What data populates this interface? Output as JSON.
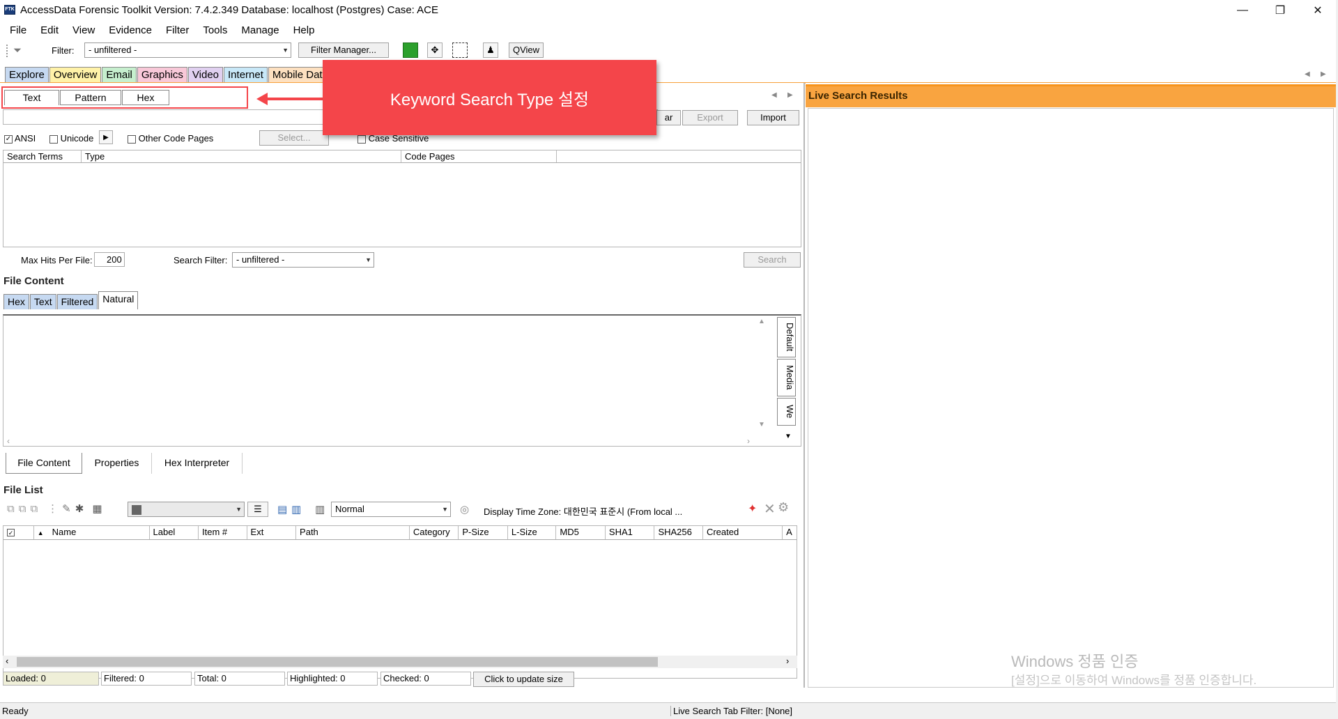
{
  "window": {
    "title": "AccessData Forensic Toolkit Version: 7.4.2.349 Database: localhost (Postgres) Case: ACE",
    "app_icon_text": "FTK",
    "minimize": "—",
    "restore": "❐",
    "close": "✕"
  },
  "menu": [
    "File",
    "Edit",
    "View",
    "Evidence",
    "Filter",
    "Tools",
    "Manage",
    "Help"
  ],
  "toolbar": {
    "filter_label": "Filter:",
    "filter_value": "- unfiltered -",
    "filter_manager": "Filter Manager...",
    "qview": "QView"
  },
  "main_tabs": [
    {
      "label": "Explore",
      "color": "#c6d9f1"
    },
    {
      "label": "Overview",
      "color": "#fff2a8"
    },
    {
      "label": "Email",
      "color": "#c6efce"
    },
    {
      "label": "Graphics",
      "color": "#f8c8d8"
    },
    {
      "label": "Video",
      "color": "#e0d0f0"
    },
    {
      "label": "Internet",
      "color": "#c8e8f8"
    },
    {
      "label": "Mobile Data",
      "color": "#fde0c0"
    }
  ],
  "search": {
    "sub_tabs": [
      "Text",
      "Pattern",
      "Hex"
    ],
    "clear_partial": "ar",
    "export": "Export",
    "import": "Import",
    "ansi": "ANSI",
    "unicode": "Unicode",
    "other_code_pages": "Other Code Pages",
    "select": "Select...",
    "case_sensitive": "Case Sensitive",
    "columns": [
      "Search Terms",
      "Type",
      "Code Pages"
    ],
    "max_hits_label": "Max Hits Per File:",
    "max_hits_value": "200",
    "search_filter_label": "Search Filter:",
    "search_filter_value": "- unfiltered -",
    "search_button": "Search"
  },
  "file_content": {
    "title": "File Content",
    "tabs": [
      "Hex",
      "Text",
      "Filtered",
      "Natural"
    ],
    "side_tabs": [
      "Default",
      "Media",
      "We"
    ],
    "bottom_tabs": [
      "File Content",
      "Properties",
      "Hex Interpreter"
    ]
  },
  "file_list": {
    "title": "File List",
    "view_mode": "Normal",
    "time_zone": "Display Time Zone: 대한민국 표준시  (From local ...",
    "columns": [
      "Name",
      "Label",
      "Item #",
      "Ext",
      "Path",
      "Category",
      "P-Size",
      "L-Size",
      "MD5",
      "SHA1",
      "SHA256",
      "Created",
      "A"
    ],
    "stats": [
      "Loaded: 0",
      "Filtered: 0",
      "Total: 0",
      "Highlighted: 0",
      "Checked: 0"
    ],
    "update_size": "Click to update size"
  },
  "live_search": {
    "title": "Live Search Results"
  },
  "callout": {
    "text": "Keyword Search Type 설정"
  },
  "watermark": {
    "line1": "Windows 정품 인증",
    "line2": "[설정]으로 이동하여 Windows를 정품 인증합니다."
  },
  "status": {
    "left": "Ready",
    "right": "Live Search Tab Filter: [None]"
  }
}
